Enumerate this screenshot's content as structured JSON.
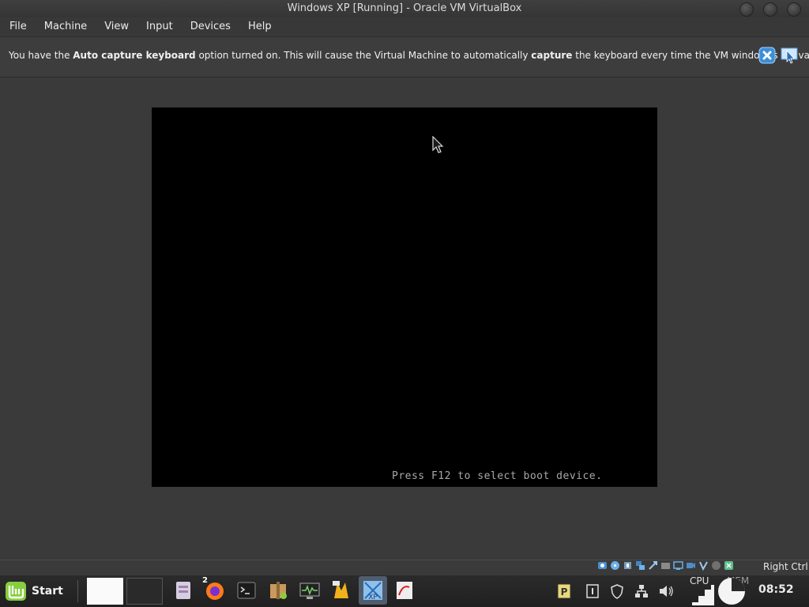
{
  "window": {
    "title": "Windows XP [Running] - Oracle VM VirtualBox"
  },
  "menu": {
    "items": [
      "File",
      "Machine",
      "View",
      "Input",
      "Devices",
      "Help"
    ]
  },
  "notification": {
    "text_1": "You have the ",
    "bold_1": "Auto capture keyboard",
    "text_2": " option turned on. This will cause the Virtual Machine to automatically ",
    "bold_2": "capture",
    "text_3": " the keyboard every time the VM window is activated and"
  },
  "vm": {
    "boot_message": "Press F12 to select boot device."
  },
  "statusbar": {
    "host_key": "Right Ctrl"
  },
  "taskbar": {
    "start_label": "Start",
    "firefox_badge": "2",
    "cpu_label": "CPU",
    "mem_label": "MEM",
    "clock": "08:52"
  },
  "colors": {
    "accent": "#87cf3e",
    "vm_background": "#000000",
    "boot_text": "#a8a8a8"
  }
}
